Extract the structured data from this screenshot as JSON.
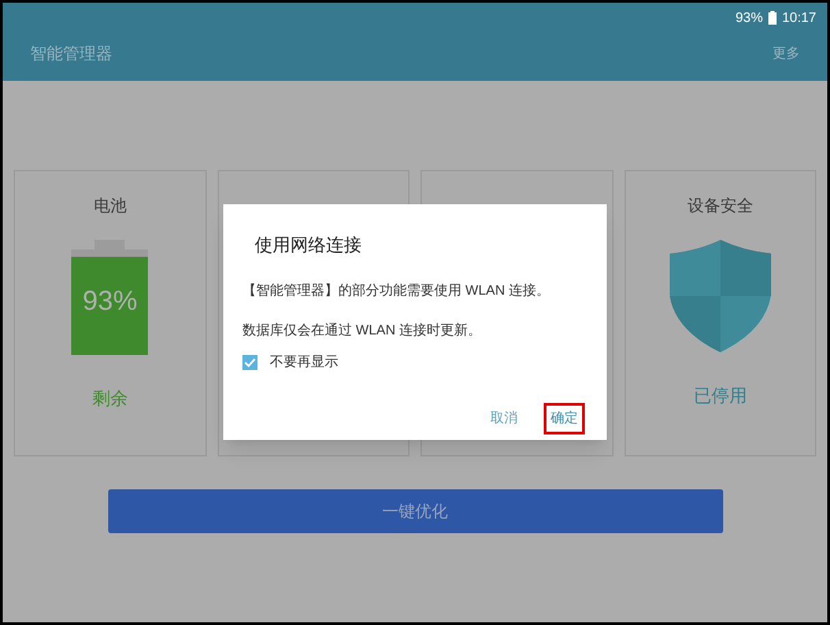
{
  "status_bar": {
    "battery": "93%",
    "time": "10:17"
  },
  "app_bar": {
    "title": "智能管理器",
    "menu": "更多"
  },
  "cards": [
    {
      "kind": "battery",
      "title": "电池",
      "reading": "93%",
      "level": 0.93,
      "status": "剩余"
    },
    {
      "kind": "storage"
    },
    {
      "kind": "memory"
    },
    {
      "kind": "security",
      "title": "设备安全",
      "status": "已停用"
    }
  ],
  "optimize_button": "一键优化",
  "dialog": {
    "title": "使用网络连接",
    "message": "【智能管理器】的部分功能需要使用 WLAN 连接。",
    "note": "数据库仅会在通过 WLAN 连接时更新。",
    "checkbox": {
      "label": "不要再显示",
      "checked": true
    },
    "buttons": [
      {
        "label": "取消",
        "highlighted": false
      },
      {
        "label": "确定",
        "highlighted": true
      }
    ]
  }
}
